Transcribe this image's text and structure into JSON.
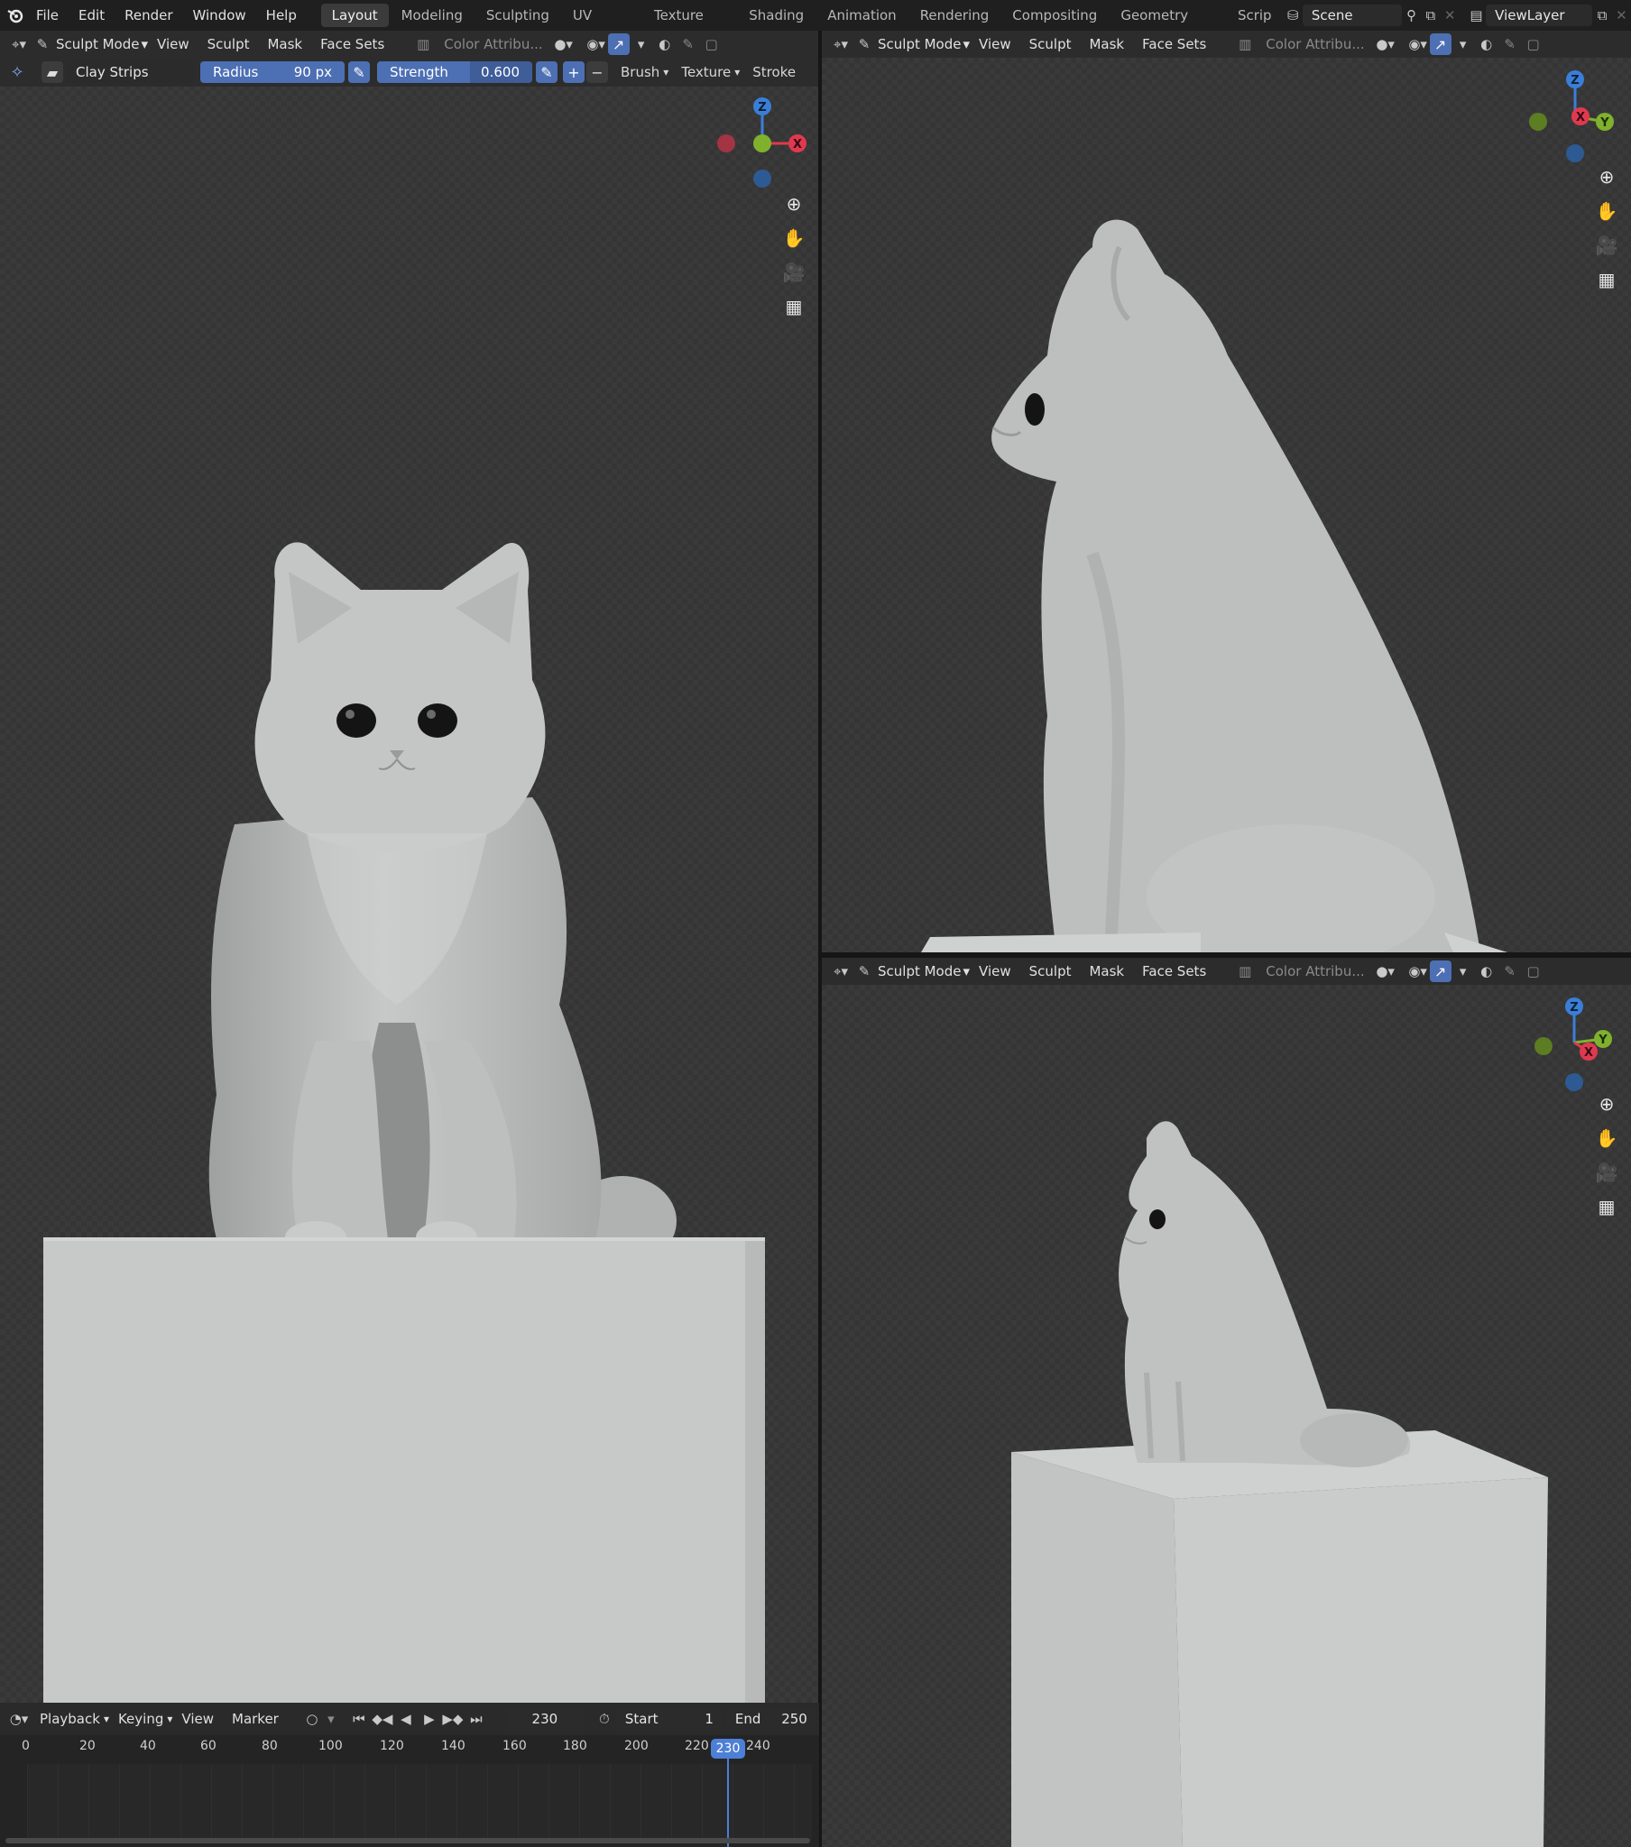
{
  "topbar": {
    "menus": [
      "File",
      "Edit",
      "Render",
      "Window",
      "Help"
    ],
    "workspaces": [
      "Layout",
      "Modeling",
      "Sculpting",
      "UV Editing",
      "Texture Paint",
      "Shading",
      "Animation",
      "Rendering",
      "Compositing",
      "Geometry Nodes",
      "Scrip"
    ],
    "active_workspace": "Layout",
    "scene": "Scene",
    "view_layer": "ViewLayer"
  },
  "viewport_header": {
    "mode": "Sculpt Mode",
    "menus": [
      "View",
      "Sculpt",
      "Mask",
      "Face Sets"
    ],
    "color_attr": "Color Attribu..."
  },
  "tool_header": {
    "brush_name": "Clay Strips",
    "radius_label": "Radius",
    "radius_value": "90 px",
    "strength_label": "Strength",
    "strength_value": "0.600",
    "menus": [
      "Brush",
      "Texture",
      "Stroke"
    ]
  },
  "gizmo_labels": {
    "z": "Z",
    "x": "X",
    "y": "Y"
  },
  "timeline": {
    "menus": [
      "Playback",
      "Keying",
      "View",
      "Marker"
    ],
    "current_frame": "230",
    "start_label": "Start",
    "start_value": "1",
    "end_label": "End",
    "end_value": "250",
    "ticks": [
      "0",
      "20",
      "40",
      "60",
      "80",
      "100",
      "120",
      "140",
      "160",
      "180",
      "200",
      "220",
      "240"
    ],
    "playhead_label": "230"
  },
  "colors": {
    "accent": "#4d6fb3",
    "x_axis": "#e0394f",
    "y_axis": "#7fb12d",
    "z_axis": "#3b7ed8",
    "model": "#bfc0c0"
  }
}
